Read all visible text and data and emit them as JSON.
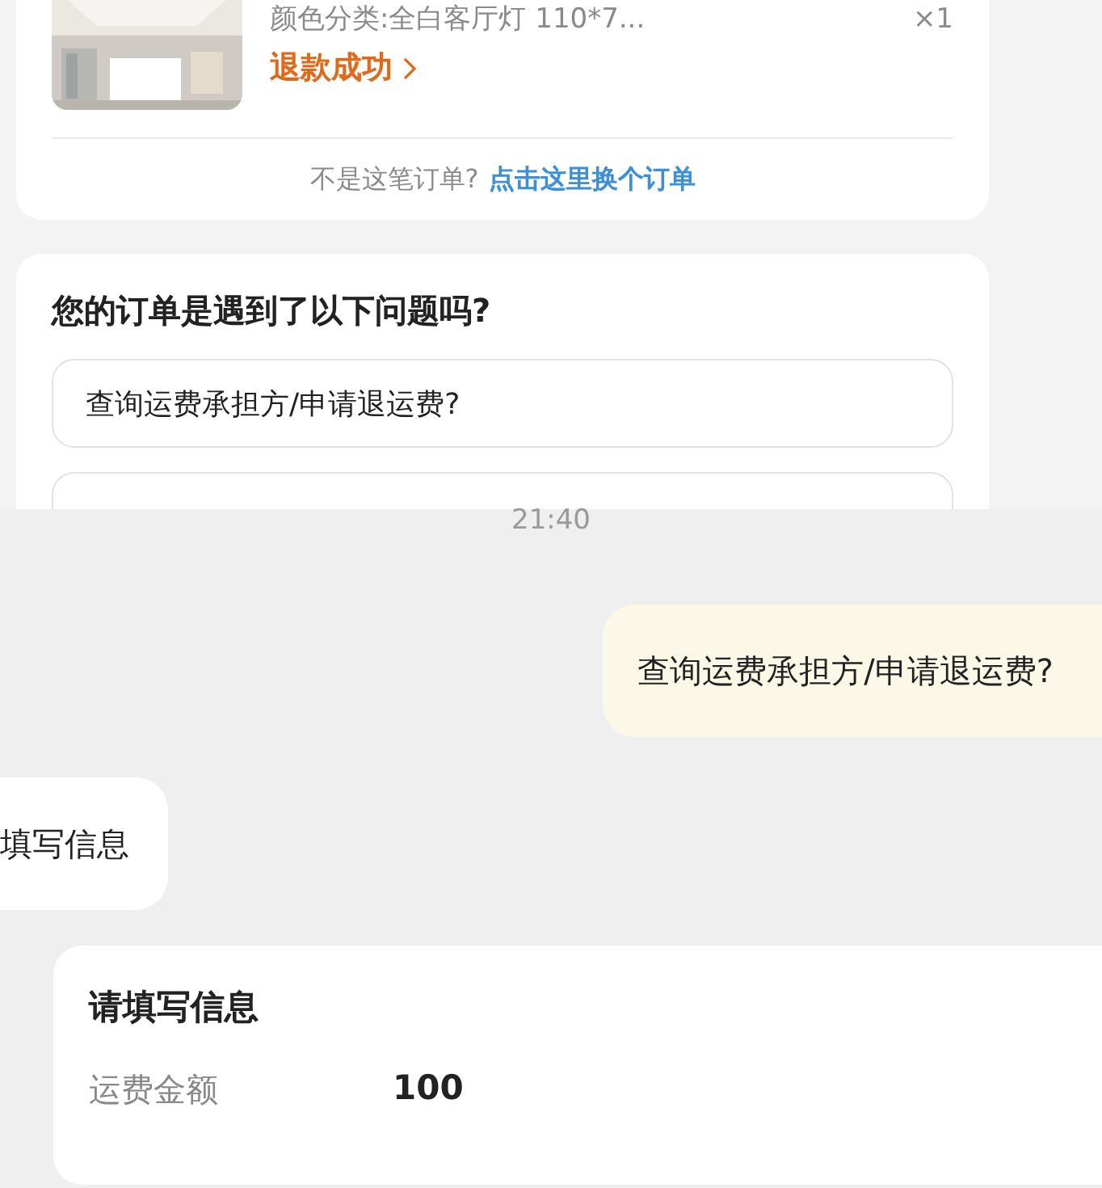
{
  "order": {
    "spec": "颜色分类:全白客厅灯 110*7...",
    "quantity": "×1",
    "status": "退款成功",
    "switch_prompt": "不是这笔订单?",
    "switch_link": "点击这里换个订单"
  },
  "question_card": {
    "title": "您的订单是遇到了以下问题吗?",
    "options": [
      "查询运费承担方/申请退运费?"
    ]
  },
  "timestamp": "21:40",
  "messages": [
    {
      "kind": "sent",
      "text": "查询运费承担方/申请退运费?"
    },
    {
      "kind": "received",
      "text": "填写信息"
    }
  ],
  "form_card": {
    "title": "请填写信息",
    "fields": [
      {
        "label": "运费金额",
        "value": "100"
      }
    ]
  }
}
